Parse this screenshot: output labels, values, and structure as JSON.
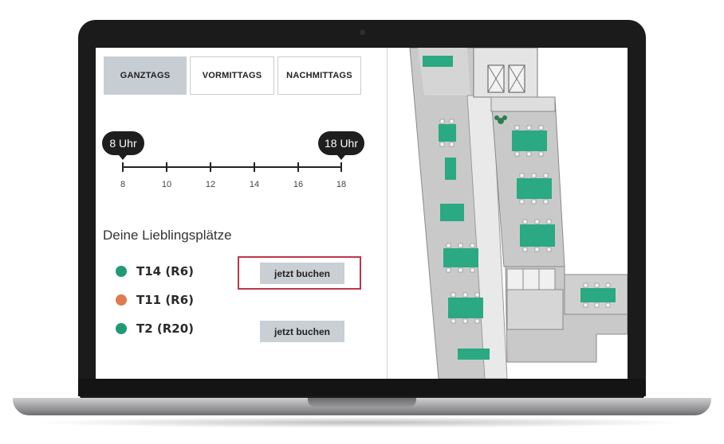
{
  "tabs": [
    {
      "label": "GANZTAGS",
      "active": true
    },
    {
      "label": "VORMITTAGS",
      "active": false
    },
    {
      "label": "NACHMITTAGS",
      "active": false
    }
  ],
  "timeline": {
    "start_label": "8 Uhr",
    "end_label": "18 Uhr",
    "ticks": [
      "8",
      "10",
      "12",
      "14",
      "16",
      "18"
    ]
  },
  "favorites": {
    "title": "Deine Lieblingsplätze",
    "items": [
      {
        "label": "T14 (R6)",
        "status_color": "#1f9a74",
        "button": "jetzt buchen"
      },
      {
        "label": "T11 (R6)",
        "status_color": "#e07a4f",
        "button": null
      },
      {
        "label": "T2 (R20)",
        "status_color": "#1f9a74",
        "button": "jetzt buchen"
      }
    ]
  },
  "colors": {
    "available": "#1f9a74",
    "occupied": "#e07a4f",
    "desk": "#2aa982",
    "highlight": "#c0354b"
  }
}
